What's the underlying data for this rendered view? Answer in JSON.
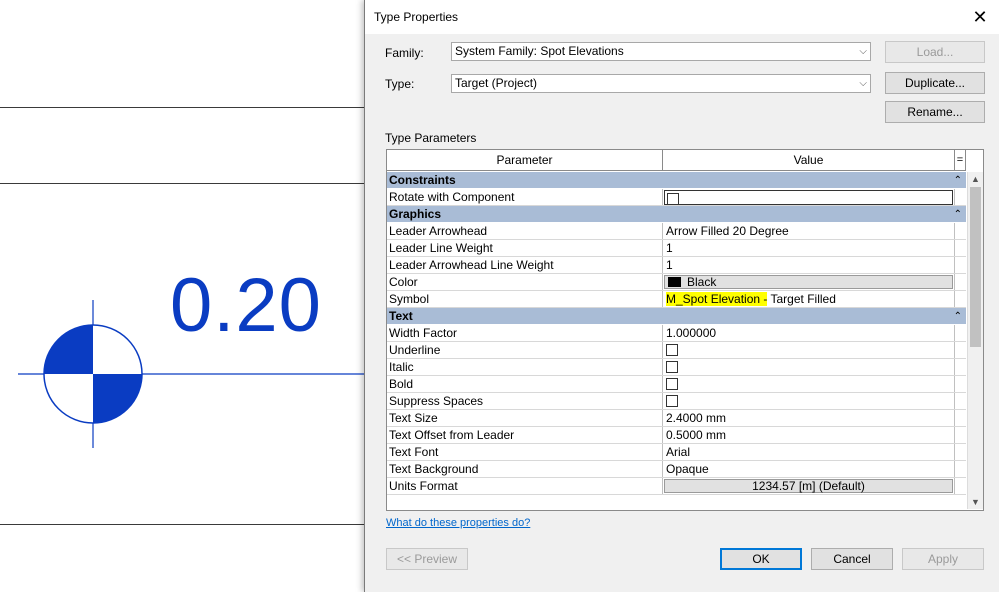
{
  "canvas": {
    "elevation_value": "0.20",
    "accent_color": "#0a3cc2"
  },
  "dialog": {
    "title": "Type Properties",
    "family_label": "Family:",
    "family_value": "System Family: Spot Elevations",
    "type_label": "Type:",
    "type_value": "Target (Project)",
    "load_button": "Load...",
    "duplicate_button": "Duplicate...",
    "rename_button": "Rename...",
    "type_parameters_label": "Type Parameters",
    "grid": {
      "header_parameter": "Parameter",
      "header_value": "Value",
      "header_eq": "=",
      "constraints": {
        "title": "Constraints",
        "rotate_with_component": {
          "name": "Rotate with Component",
          "checked": false
        }
      },
      "graphics": {
        "title": "Graphics",
        "leader_arrowhead": {
          "name": "Leader Arrowhead",
          "value": "Arrow Filled 20 Degree"
        },
        "leader_line_weight": {
          "name": "Leader Line Weight",
          "value": "1"
        },
        "leader_arrowhead_line_weight": {
          "name": "Leader Arrowhead Line Weight",
          "value": "1"
        },
        "color": {
          "name": "Color",
          "value": "Black",
          "swatch": "#000000"
        },
        "symbol": {
          "name": "Symbol",
          "value_highlighted": "M_Spot Elevation -",
          "value_rest": " Target Filled",
          "highlight_color": "#ffff00"
        }
      },
      "text": {
        "title": "Text",
        "width_factor": {
          "name": "Width Factor",
          "value": "1.000000"
        },
        "underline": {
          "name": "Underline",
          "checked": false
        },
        "italic": {
          "name": "Italic",
          "checked": false
        },
        "bold": {
          "name": "Bold",
          "checked": false
        },
        "suppress_spaces": {
          "name": "Suppress Spaces",
          "checked": false
        },
        "text_size": {
          "name": "Text Size",
          "value": "2.4000 mm"
        },
        "text_offset_from_leader": {
          "name": "Text Offset from Leader",
          "value": "0.5000 mm"
        },
        "text_font": {
          "name": "Text Font",
          "value": "Arial"
        },
        "text_background": {
          "name": "Text Background",
          "value": "Opaque"
        },
        "units_format": {
          "name": "Units Format",
          "value": "1234.57 [m] (Default)"
        }
      }
    },
    "help_link": "What do these properties do?",
    "preview_button": "<< Preview",
    "ok_button": "OK",
    "cancel_button": "Cancel",
    "apply_button": "Apply",
    "category_color": "#a9bcd6",
    "default_button_border": "#0078d7"
  }
}
